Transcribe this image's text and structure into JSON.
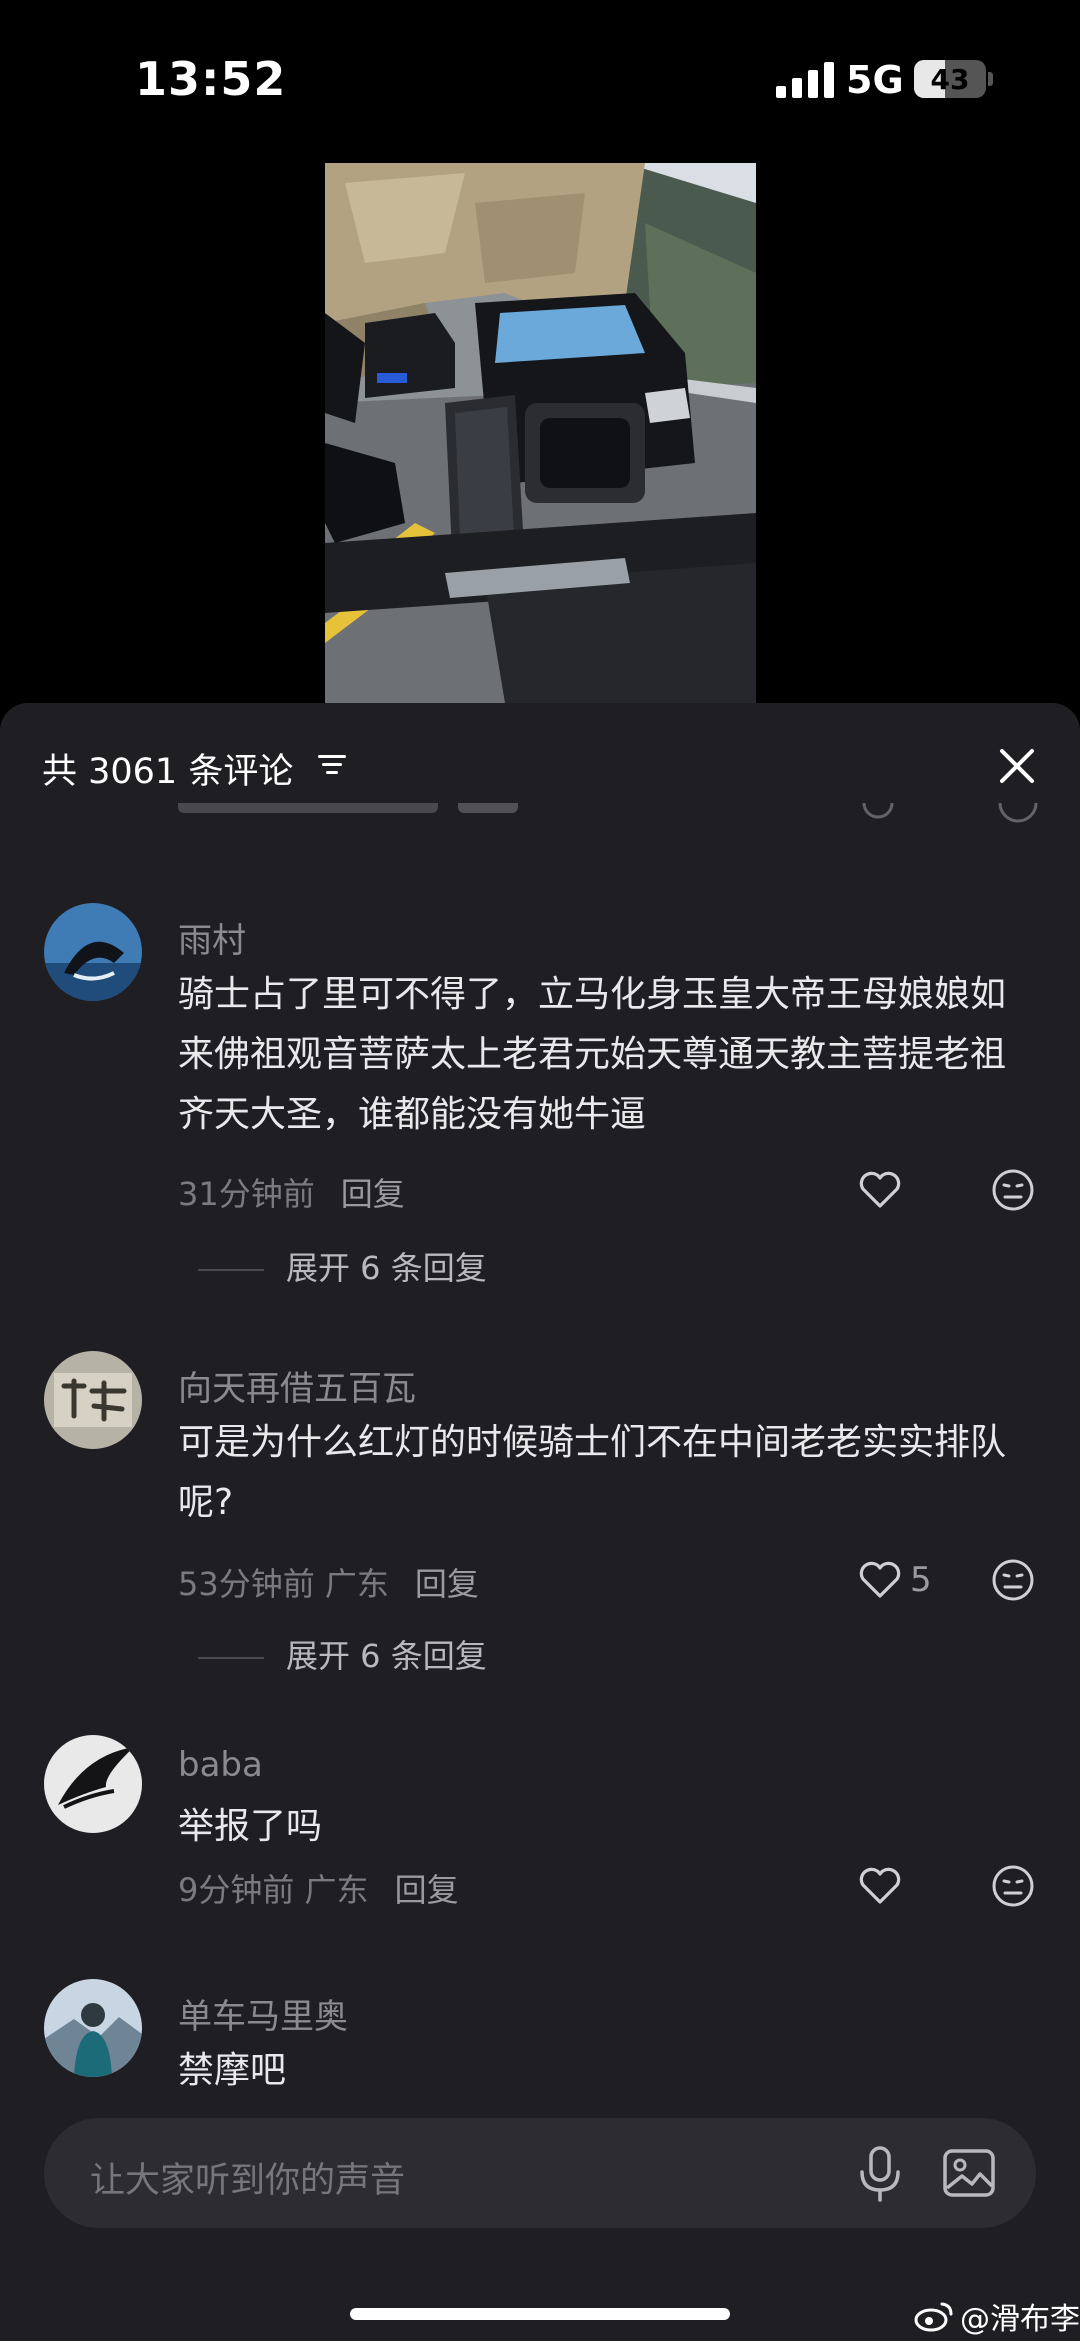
{
  "status_bar": {
    "time": "13:52",
    "network": "5G",
    "battery": "43",
    "battery_level": 0.43
  },
  "video": {
    "subject": "motorcycle rider facing a black car on a mountain road"
  },
  "comments_panel": {
    "count_label": "共 3061 条评论",
    "sort_icon": "filter-lines-icon",
    "close_icon": "close-icon"
  },
  "comments": [
    {
      "username": "雨村",
      "text": "骑士占了里可不得了，立马化身玉皇大帝王母娘娘如来佛祖观音菩萨太上老君元始天尊通天教主菩提老祖齐天大圣，谁都能没有她牛逼",
      "time": "31分钟前",
      "location": "",
      "reply_label": "回复",
      "likes": "",
      "expand_label": "展开 6 条回复"
    },
    {
      "username": "向天再借五百瓦",
      "text": "可是为什么红灯的时候骑士们不在中间老老实实排队呢?",
      "time": "53分钟前",
      "location": "广东",
      "reply_label": "回复",
      "likes": "5",
      "expand_label": "展开 6 条回复"
    },
    {
      "username": "baba",
      "text": "举报了吗",
      "time": "9分钟前",
      "location": "广东",
      "reply_label": "回复",
      "likes": ""
    },
    {
      "username": "单车马里奥",
      "text": "禁摩吧"
    }
  ],
  "input": {
    "placeholder": "让大家听到你的声音",
    "mic_icon": "microphone-icon",
    "image_icon": "image-icon"
  },
  "watermark": {
    "text": "@滑布李"
  },
  "colors": {
    "sheet_bg": "#1f1f23",
    "input_bg": "#2c2c31",
    "muted_text": "#7a7a80"
  }
}
